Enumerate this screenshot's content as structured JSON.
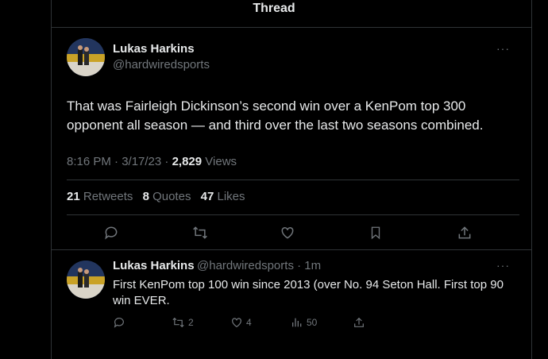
{
  "header": {
    "title": "Thread"
  },
  "main_tweet": {
    "author_name": "Lukas Harkins",
    "author_handle": "@hardwiredsports",
    "more": "···",
    "text": "That was Fairleigh Dickinson’s second win over a KenPom top 300 opponent all season — and third over the last two seasons combined.",
    "time": "8:16 PM · 3/17/23 · ",
    "views_count": "2,829",
    "views_label": " Views",
    "retweets_count": "21",
    "retweets_label": "Retweets",
    "quotes_count": "8",
    "quotes_label": "Quotes",
    "likes_count": "47",
    "likes_label": "Likes",
    "actions": [
      "reply-icon",
      "retweet-icon",
      "like-icon",
      "bookmark-icon",
      "share-icon"
    ]
  },
  "reply_tweet": {
    "author_name": "Lukas Harkins",
    "author_handle": "@hardwiredsports · 1m",
    "more": "···",
    "text": "First KenPom top 100 win since 2013 (over No. 94 Seton Hall. First top 90 win EVER.",
    "retweets": "2",
    "likes": "4",
    "views": "50"
  },
  "colors": {
    "background": "#000000",
    "text": "#e7e9ea",
    "muted": "#71767b",
    "border": "#2f3336"
  }
}
